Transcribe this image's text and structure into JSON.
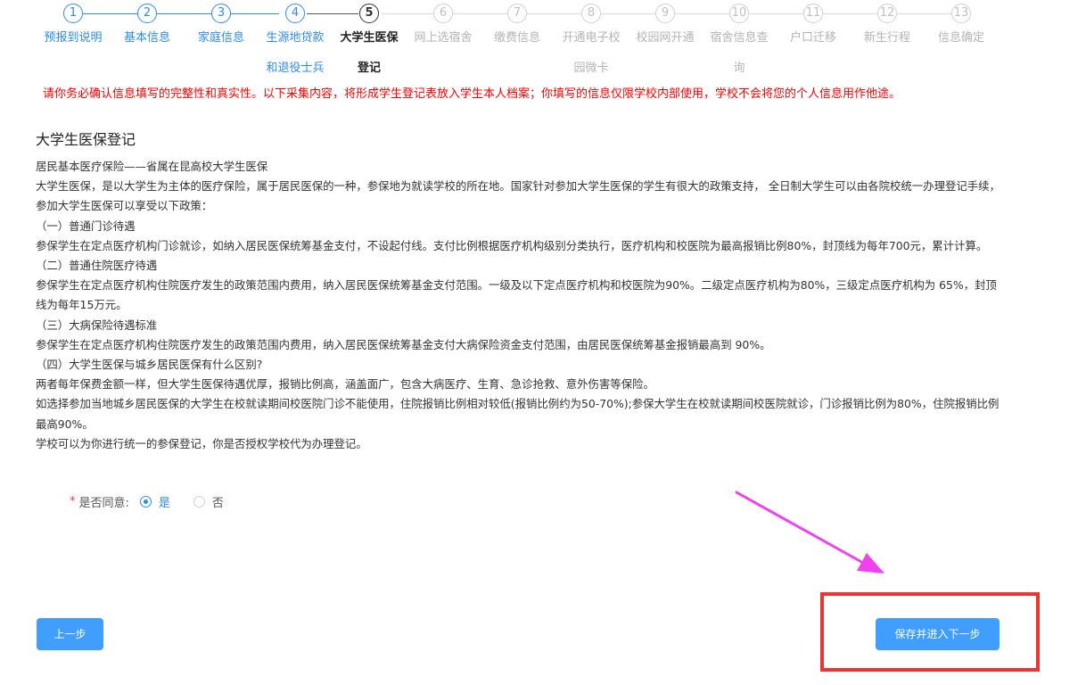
{
  "stepper": {
    "steps": [
      {
        "num": "1",
        "line1": "预报到说明",
        "line2": "",
        "state": "done"
      },
      {
        "num": "2",
        "line1": "基本信息",
        "line2": "",
        "state": "done"
      },
      {
        "num": "3",
        "line1": "家庭信息",
        "line2": "",
        "state": "done"
      },
      {
        "num": "4",
        "line1": "生源地贷款",
        "line2": "和退役士兵",
        "state": "done"
      },
      {
        "num": "5",
        "line1": "大学生医保",
        "line2": "登记",
        "state": "current"
      },
      {
        "num": "6",
        "line1": "网上选宿舍",
        "line2": "",
        "state": "todo"
      },
      {
        "num": "7",
        "line1": "缴费信息",
        "line2": "",
        "state": "todo"
      },
      {
        "num": "8",
        "line1": "开通电子校",
        "line2": "园微卡",
        "state": "todo"
      },
      {
        "num": "9",
        "line1": "校园网开通",
        "line2": "",
        "state": "todo"
      },
      {
        "num": "10",
        "line1": "宿舍信息查",
        "line2": "询",
        "state": "todo"
      },
      {
        "num": "11",
        "line1": "户口迁移",
        "line2": "",
        "state": "todo"
      },
      {
        "num": "12",
        "line1": "新生行程",
        "line2": "",
        "state": "todo"
      },
      {
        "num": "13",
        "line1": "信息确定",
        "line2": "",
        "state": "todo"
      }
    ]
  },
  "notice": "请你务必确认信息填写的完整性和真实性。以下采集内容，将形成学生登记表放入学生本人档案；你填写的信息仅限学校内部使用，学校不会将您的个人信息用作他途。",
  "section": {
    "title": "大学生医保登记",
    "paragraphs": [
      "居民基本医疗保险——省属在昆高校大学生医保",
      "大学生医保，是以大学生为主体的医疗保险，属于居民医保的一种，参保地为就读学校的所在地。国家针对参加大学生医保的学生有很大的政策支持， 全日制大学生可以由各院校统一办理登记手续，参加大学生医保可以享受以下政策：",
      "（一）普通门诊待遇",
      "参保学生在定点医疗机构门诊就诊，如纳入居民医保统筹基金支付，不设起付线。支付比例根据医疗机构级别分类执行，医疗机构和校医院为最高报销比例80%，封顶线为每年700元，累计计算。",
      "（二）普通住院医疗待遇",
      "参保学生在定点医疗机构住院医疗发生的政策范围内费用，纳入居民医保统筹基金支付范围。一级及以下定点医疗机构和校医院为90%。二级定点医疗机构为80%，三级定点医疗机构为 65%，封顶线为每年15万元。",
      "（三）大病保险待遇标准",
      "参保学生在定点医疗机构住院医疗发生的政策范围内费用，纳入居民医保统筹基金支付大病保险资金支付范围，由居民医保统筹基金报销最高到 90%。",
      "（四）大学生医保与城乡居民医保有什么区别?",
      "两者每年保费金额一样，但大学生医保待遇优厚，报销比例高，涵盖面广，包含大病医疗、生育、急诊抢救、意外伤害等保险。",
      "如选择参加当地城乡居民医保的大学生在校就读期间校医院门诊不能使用，住院报销比例相对较低(报销比例约为50-70%);参保大学生在校就读期间校医院就诊，门诊报销比例为80%，住院报销比例最高90%。",
      "学校可以为你进行统一的参保登记，你是否授权学校代为办理登记。"
    ]
  },
  "agree": {
    "required_mark": "*",
    "label": "是否同意:",
    "options": [
      {
        "label": "是",
        "checked": true
      },
      {
        "label": "否",
        "checked": false
      }
    ]
  },
  "buttons": {
    "prev": "上一步",
    "next": "保存并进入下一步"
  },
  "colors": {
    "primary": "#2d8cf0",
    "button": "#409eff",
    "notice": "#ff0000",
    "highlight": "#ee3333",
    "arrow": "#f040f0"
  }
}
